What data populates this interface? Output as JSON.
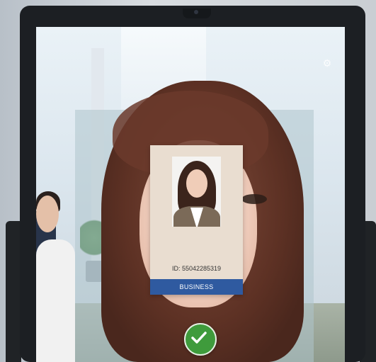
{
  "id_card": {
    "id_label": "ID: 55042285319",
    "category": "BUSINESS",
    "band_color": "#2f5aa0"
  },
  "status": {
    "verification_icon": "checkmark-circle-icon",
    "color": "#3f9b3c"
  },
  "toolbar": {
    "settings_icon": "settings-icon"
  }
}
